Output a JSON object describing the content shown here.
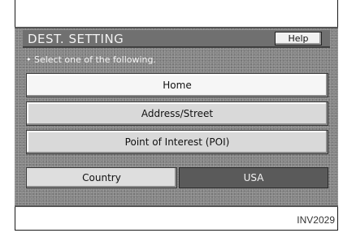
{
  "screen": {
    "title": "DEST. SETTING",
    "help_label": "Help",
    "prompt": "• Select one of the following.",
    "options": [
      {
        "label": "Home"
      },
      {
        "label": "Address/Street"
      },
      {
        "label": "Point of Interest (POI)"
      }
    ],
    "country": {
      "label": "Country",
      "value": "USA"
    }
  },
  "figure_id": "INV2029"
}
